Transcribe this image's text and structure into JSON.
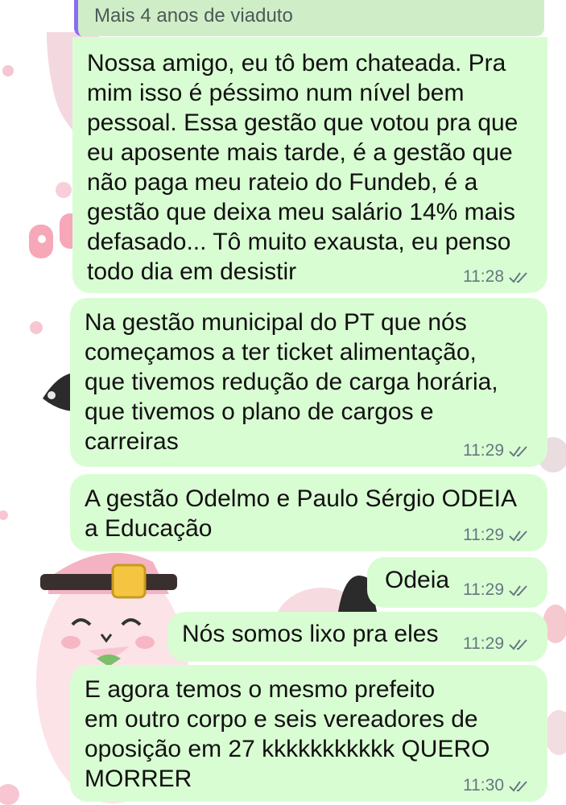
{
  "quote": {
    "text": "Mais 4 anos de viaduto"
  },
  "messages": [
    {
      "text": "Nossa amigo, eu tô bem chateada. Pra\nmim isso é péssimo num nível bem\npessoal. Essa gestão que votou pra que\neu aposente mais tarde, é a gestão que\nnão paga meu rateio do Fundeb, é a\ngestão que deixa meu salário 14% mais\ndefasado... Tô muito exausta, eu penso\ntodo dia em desistir",
      "time": "11:28"
    },
    {
      "text": "Na gestão municipal do PT que nós\ncomeçamos a ter ticket alimentação,\nque tivemos redução de carga horária,\nque tivemos o plano de cargos e\ncarreiras",
      "time": "11:29"
    },
    {
      "text": "A gestão Odelmo e Paulo Sérgio ODEIA\na Educação",
      "time": "11:29"
    },
    {
      "text": "Odeia",
      "time": "11:29"
    },
    {
      "text": "Nós somos lixo pra eles",
      "time": "11:29"
    },
    {
      "text": "E agora temos o mesmo prefeito\nem outro corpo e seis vereadores de\noposição em 27 kkkkkkkkkkk QUERO\nMORRER",
      "time": "11:30"
    }
  ],
  "colors": {
    "bubble": "#d9fdd3",
    "quote_bar": "#8b6cf0",
    "meta": "#667781"
  },
  "icons": {
    "read_receipt": "double-check-icon"
  }
}
